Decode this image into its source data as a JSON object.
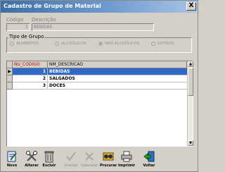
{
  "window": {
    "title": "Cadastro de Grupo de Material",
    "close_label": "X"
  },
  "form": {
    "codigo_label": "Código",
    "codigo_value": "1",
    "descricao_label": "Descrição",
    "descricao_value": "BEBIDAS"
  },
  "tipo_grupo": {
    "legend": "Tipo de Grupo",
    "options": [
      "ALIMENTOS",
      "ALCOÓLICOS",
      "NÃO ALCOÓLICOS",
      "OUTROS"
    ],
    "selected": "NÃO ALCOÓLICOS"
  },
  "grid": {
    "columns": [
      "NU_CODIGO",
      "NM_DESCRICAO"
    ],
    "rows": [
      {
        "codigo": "1",
        "descricao": "BEBIDAS",
        "selected": true,
        "indicator": "▶"
      },
      {
        "codigo": "2",
        "descricao": "SALGADOS",
        "selected": false,
        "indicator": ""
      },
      {
        "codigo": "3",
        "descricao": "DOCES",
        "selected": false,
        "indicator": ""
      }
    ],
    "scroll_up": "▲",
    "scroll_down": "▼"
  },
  "toolbar": {
    "novo": "Novo",
    "alterar": "Alterar",
    "excluir": "Excluir",
    "gravar": "Gravar",
    "cancelar": "Cancelar",
    "procurar": "Procurar",
    "imprimir": "Imprimir",
    "voltar": "Voltar"
  },
  "colors": {
    "title_start": "#3c6ea6",
    "selection": "#3169c6",
    "column_header_red": "#c00000"
  }
}
